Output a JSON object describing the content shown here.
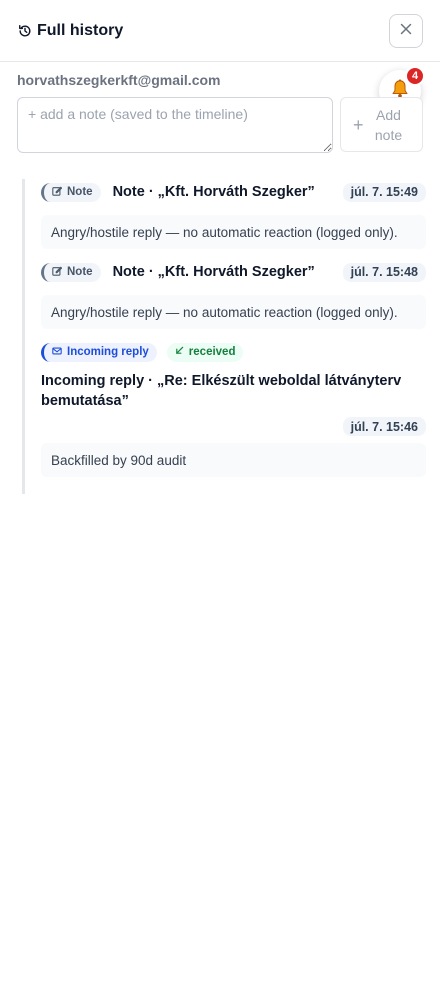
{
  "header": {
    "title": "Full history",
    "history_icon": "history-icon",
    "close_icon": "close-icon"
  },
  "contact": {
    "email": "horvathszegkerkft@gmail.com"
  },
  "notifications": {
    "icon": "bell-icon",
    "count": "4"
  },
  "note_form": {
    "placeholder": "+ add a note (saved to the timeline)",
    "value": "",
    "add_plus": "+",
    "add_label": "Add note"
  },
  "timeline": [
    {
      "type_label": "Note",
      "type_icon": "edit-icon",
      "title": "Note · „Kft. Horváth Szegker”",
      "time": "júl. 7. 15:49",
      "body": "Angry/hostile reply — no automatic reaction (logged only)."
    },
    {
      "type_label": "Note",
      "type_icon": "edit-icon",
      "title": "Note · „Kft. Horváth Szegker”",
      "time": "júl. 7. 15:48",
      "body": "Angry/hostile reply — no automatic reaction (logged only)."
    },
    {
      "type_label": "Incoming reply",
      "type_icon": "mail-icon",
      "status_label": "received",
      "status_icon": "arrow-down-left-icon",
      "title": "Incoming reply · „Re: Elkészült weboldal látványterv bemutatása”",
      "time": "júl. 7. 15:46",
      "body": "Backfilled by 90d audit"
    }
  ],
  "colors": {
    "note_accent": "#64748b",
    "reply_accent": "#1d4ed8",
    "received_green": "#15803d",
    "badge_red": "#dc2626"
  }
}
